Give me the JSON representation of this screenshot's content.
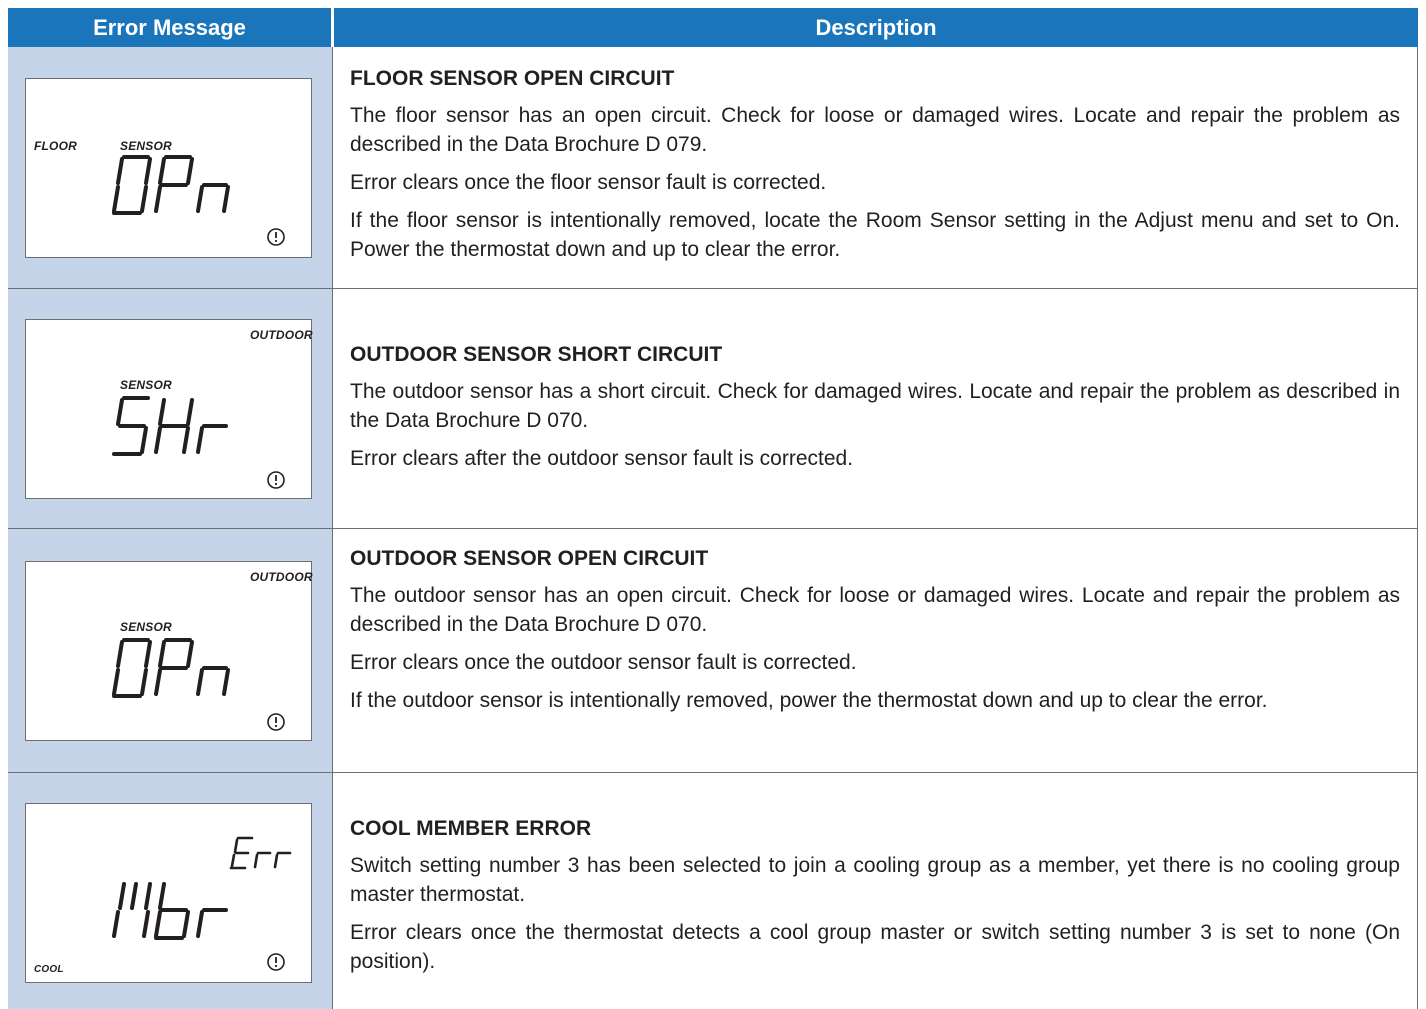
{
  "header": {
    "col1": "Error Message",
    "col2": "Description"
  },
  "rows": [
    {
      "lcd": {
        "label_left": "FLOOR",
        "label_mid": "SENSOR",
        "label_top_right": "",
        "label_bottom_left": "",
        "code": "OPn",
        "alert_icon": "alert-circle-icon"
      },
      "title": "FLOOR SENSOR OPEN CIRCUIT",
      "paragraphs": [
        "The floor sensor has an open circuit. Check for loose or damaged wires. Locate and repair the problem as described in the Data Brochure D 079.",
        "Error clears once the floor sensor fault is corrected.",
        "If the floor sensor is intentionally removed, locate the Room Sensor setting in the Adjust menu and set to On. Power the thermostat down and up to clear the error."
      ]
    },
    {
      "lcd": {
        "label_left": "",
        "label_mid": "SENSOR",
        "label_top_right": "OUTDOOR",
        "label_bottom_left": "",
        "code": "SHr",
        "alert_icon": "alert-circle-icon"
      },
      "title": "OUTDOOR SENSOR SHORT CIRCUIT",
      "paragraphs": [
        "The outdoor sensor has a short circuit. Check for damaged wires. Locate and repair the problem as described in the Data Brochure D 070.",
        "Error clears after the outdoor sensor fault is corrected."
      ]
    },
    {
      "lcd": {
        "label_left": "",
        "label_mid": "SENSOR",
        "label_top_right": "OUTDOOR",
        "label_bottom_left": "",
        "code": "OPn",
        "alert_icon": "alert-circle-icon"
      },
      "title": "OUTDOOR SENSOR OPEN CIRCUIT",
      "paragraphs": [
        "The outdoor sensor has an open circuit. Check for loose or damaged wires. Locate and repair the problem as described in the Data Brochure D 070.",
        "Error clears once the outdoor sensor fault is corrected.",
        "If the outdoor sensor is intentionally removed, power the thermostat down and up to clear the error."
      ]
    },
    {
      "lcd": {
        "label_left": "",
        "label_mid": "",
        "label_top_right": "",
        "label_bottom_left": "COOL",
        "code": "Mbr",
        "code_small": "Err",
        "alert_icon": "alert-circle-icon"
      },
      "title": "COOL MEMBER ERROR",
      "paragraphs": [
        "Switch setting number 3 has been selected to join a cooling group as a member, yet there is no cooling group master thermostat.",
        "Error clears once the thermostat detects a cool group master or switch setting number 3 is set to none (On position)."
      ]
    }
  ],
  "colors": {
    "header_bg": "#1a75bb",
    "left_col_bg": "#c6d4ea",
    "border": "#6d6e71",
    "text": "#231f20"
  }
}
